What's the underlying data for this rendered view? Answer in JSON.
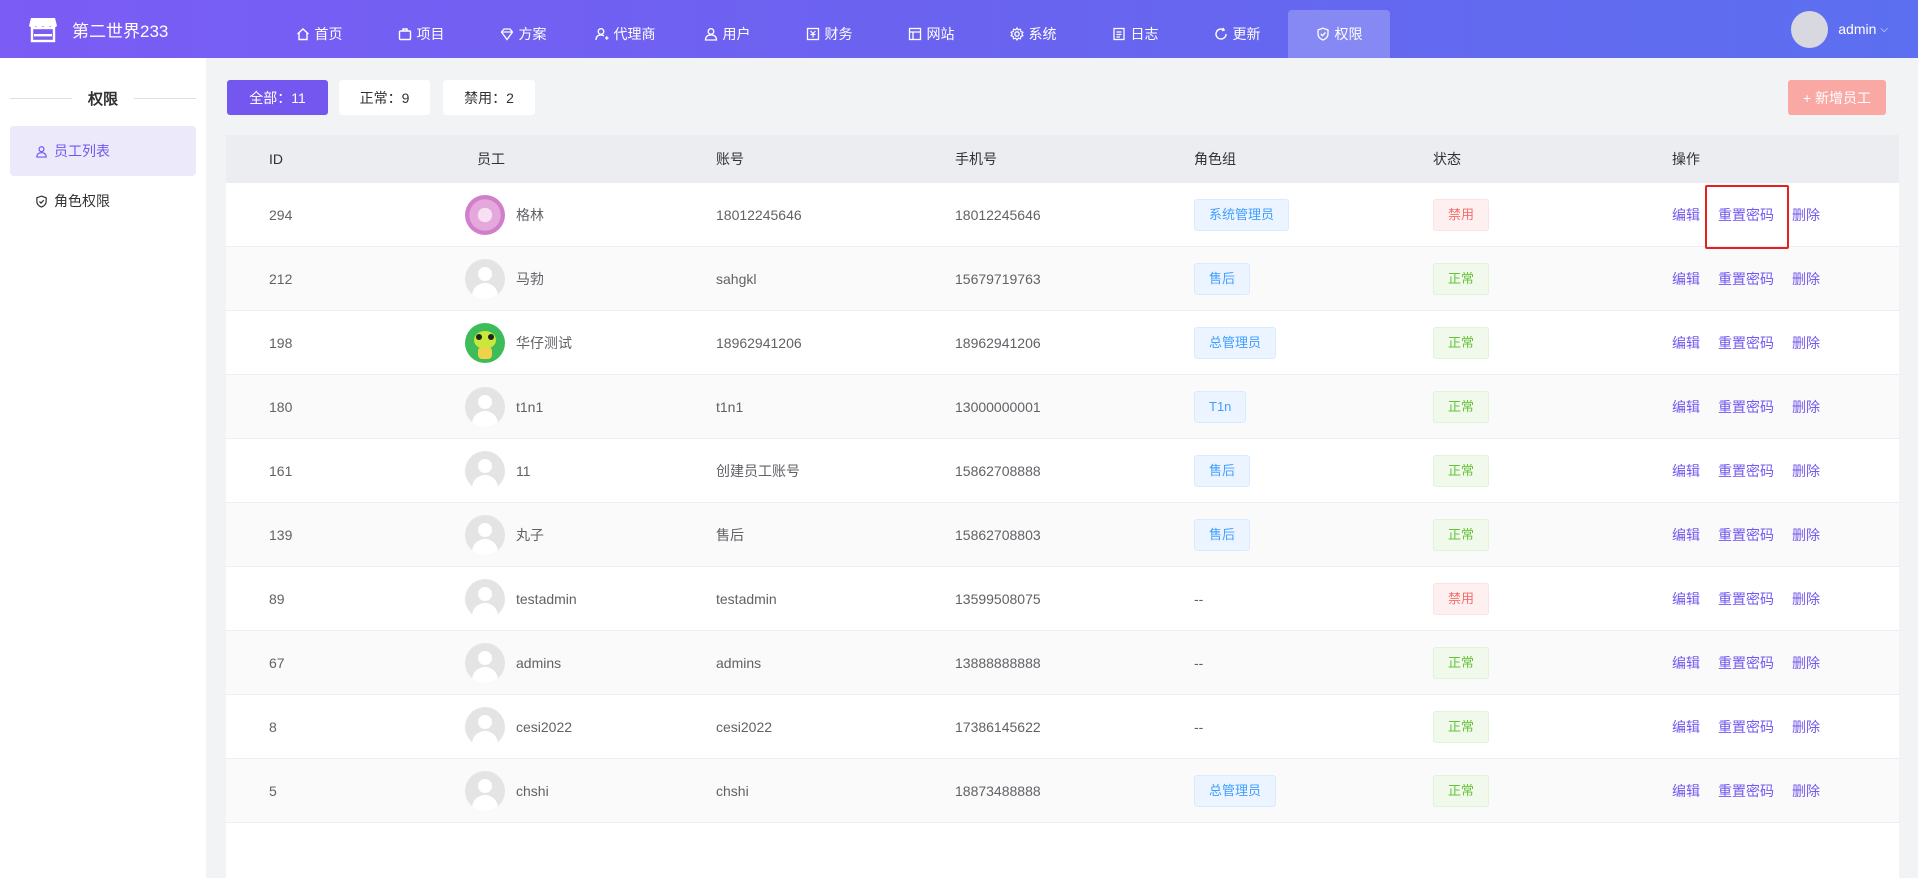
{
  "app": {
    "title": "第二世界233"
  },
  "nav": [
    {
      "label": "首页",
      "icon": "home-icon"
    },
    {
      "label": "项目",
      "icon": "briefcase-icon"
    },
    {
      "label": "方案",
      "icon": "diamond-icon"
    },
    {
      "label": "代理商",
      "icon": "user-plus-icon"
    },
    {
      "label": "用户",
      "icon": "users-icon"
    },
    {
      "label": "财务",
      "icon": "finance-icon"
    },
    {
      "label": "网站",
      "icon": "window-icon"
    },
    {
      "label": "系统",
      "icon": "gear-icon"
    },
    {
      "label": "日志",
      "icon": "document-icon"
    },
    {
      "label": "更新",
      "icon": "refresh-icon"
    },
    {
      "label": "权限",
      "icon": "shield-icon",
      "active": true
    }
  ],
  "user": {
    "name": "admin"
  },
  "sidebar": {
    "title": "权限",
    "items": [
      {
        "label": "员工列表",
        "icon": "user-icon",
        "active": true
      },
      {
        "label": "角色权限",
        "icon": "shield-check-icon"
      }
    ]
  },
  "filters": {
    "all": "全部：11",
    "normal": "正常：9",
    "banned": "禁用：2",
    "add": "+ 新增员工"
  },
  "table": {
    "headers": [
      "ID",
      "员工",
      "账号",
      "手机号",
      "角色组",
      "状态",
      "操作"
    ],
    "rows": [
      {
        "id": "294",
        "name": "格林",
        "account": "18012245646",
        "phone": "18012245646",
        "role": "系统管理员",
        "status": "禁用",
        "avatar": "pink"
      },
      {
        "id": "212",
        "name": "马勃",
        "account": "sahgkl",
        "phone": "15679719763",
        "role": "售后",
        "status": "正常",
        "avatar": "default"
      },
      {
        "id": "198",
        "name": "华仔测试",
        "account": "18962941206",
        "phone": "18962941206",
        "role": "总管理员",
        "status": "正常",
        "avatar": "green"
      },
      {
        "id": "180",
        "name": "t1n1",
        "account": "t1n1",
        "phone": "13000000001",
        "role": "T1n",
        "status": "正常",
        "avatar": "default"
      },
      {
        "id": "161",
        "name": "11",
        "account": "创建员工账号",
        "phone": "15862708888",
        "role": "售后",
        "status": "正常",
        "avatar": "default"
      },
      {
        "id": "139",
        "name": "丸子",
        "account": "售后",
        "phone": "15862708803",
        "role": "售后",
        "status": "正常",
        "avatar": "default"
      },
      {
        "id": "89",
        "name": "testadmin",
        "account": "testadmin",
        "phone": "13599508075",
        "role": "--",
        "status": "禁用",
        "avatar": "default"
      },
      {
        "id": "67",
        "name": "admins",
        "account": "admins",
        "phone": "13888888888",
        "role": "--",
        "status": "正常",
        "avatar": "default"
      },
      {
        "id": "8",
        "name": "cesi2022",
        "account": "cesi2022",
        "phone": "17386145622",
        "role": "--",
        "status": "正常",
        "avatar": "default"
      },
      {
        "id": "5",
        "name": "chshi",
        "account": "chshi",
        "phone": "18873488888",
        "role": "总管理员",
        "status": "正常",
        "avatar": "default"
      }
    ],
    "actions": {
      "edit": "编辑",
      "reset": "重置密码",
      "delete": "删除"
    }
  },
  "colors": {
    "accent": "#7357ee",
    "add_button": "#f9a8a4",
    "tag_role": "#409eff",
    "tag_ok": "#67c23a",
    "tag_ban": "#f56c6c",
    "highlight": "#e5201e"
  },
  "icons": {
    "logo": "store-icon",
    "caret": "chevron-down-icon"
  }
}
